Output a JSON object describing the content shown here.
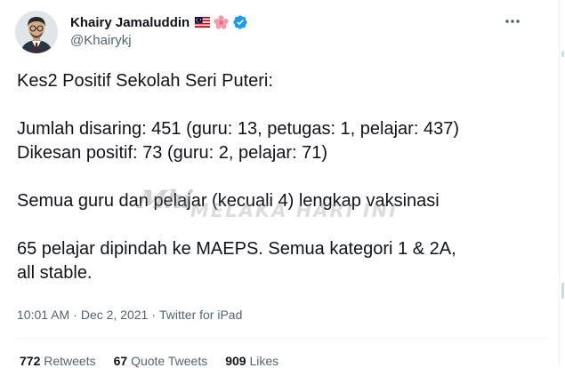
{
  "author": {
    "display_name": "Khairy Jamaluddin",
    "handle": "@Khairykj",
    "badges": [
      "malaysia-flag-emoji",
      "hibiscus-emoji",
      "verified-badge-icon"
    ]
  },
  "tweet": {
    "lines": [
      "Kes2 Positif Sekolah Seri Puteri:",
      "",
      "Jumlah disaring: 451 (guru: 13, petugas: 1, pelajar: 437)",
      "Dikesan positif: 73 (guru: 2, pelajar: 71)",
      "",
      "Semua guru dan pelajar (kecuali 4) lengkap vaksinasi",
      "",
      "65 pelajar dipindah ke MAEPS. Semua kategori 1 & 2A,",
      "all stable."
    ]
  },
  "watermark": {
    "text": "MELAKA HARI INI"
  },
  "meta": {
    "time": "10:01 AM",
    "separator": "·",
    "date": "Dec 2, 2021",
    "source": "Twitter for iPad"
  },
  "stats": {
    "retweets_count": "772",
    "retweets_label": "Retweets",
    "quotes_count": "67",
    "quotes_label": "Quote Tweets",
    "likes_count": "909",
    "likes_label": "Likes"
  },
  "colors": {
    "text_primary": "#0f1419",
    "text_secondary": "#536471",
    "verified_blue": "#1d9bf0",
    "divider": "#eff3f4"
  }
}
